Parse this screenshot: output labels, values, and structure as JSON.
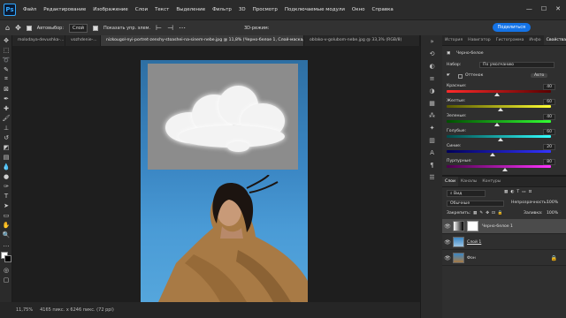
{
  "app": {
    "logo": "Ps"
  },
  "menu": [
    "Файл",
    "Редактирование",
    "Изображение",
    "Слои",
    "Текст",
    "Выделение",
    "Фильтр",
    "3D",
    "Просмотр",
    "Подключаемые модули",
    "Окно",
    "Справка"
  ],
  "window_controls": [
    "—",
    "☐",
    "✕"
  ],
  "options": {
    "auto_select_label": "Автовыбор:",
    "auto_select_value": "Слой",
    "show_controls_label": "Показать упр. элем.",
    "mode_3d_label": "3D-режим:",
    "share_label": "Поделиться"
  },
  "tabs": [
    {
      "label": "molodaya-devushka-...",
      "active": false
    },
    {
      "label": "vozhdenie-...",
      "active": false
    },
    {
      "label": "nizkougol-nyi-portret-zenshy-stoashei-na-sinem-nebe.jpg @ 11,8% (Черно-белое 1, Слой-маска/8) *",
      "active": true
    },
    {
      "label": "oblako-v-golubom-nebe.jpg @ 33,3% (RGB/8)",
      "active": false
    }
  ],
  "status": {
    "zoom": "11,75%",
    "doc_size": "4165 пикс. x 6246 пикс. (72 ppi)"
  },
  "properties": {
    "tabs": [
      "История",
      "Навигатор",
      "Гистограмма",
      "Инфо",
      "Свойства"
    ],
    "title": "Черно-белое",
    "preset_label": "Набор:",
    "preset_value": "По умолчанию",
    "tint_label": "Оттенок",
    "auto_label": "Авто",
    "sliders": [
      {
        "label": "Красные:",
        "value": 40,
        "color_from": "#ff2a2a",
        "color_to": "#5a0000"
      },
      {
        "label": "Желтые:",
        "value": 60,
        "color_from": "#5a5a00",
        "color_to": "#ffff33"
      },
      {
        "label": "Зеленые:",
        "value": 40,
        "color_from": "#004d00",
        "color_to": "#33ff33"
      },
      {
        "label": "Голубые:",
        "value": 60,
        "color_from": "#004d4d",
        "color_to": "#33ffff"
      },
      {
        "label": "Синие:",
        "value": 20,
        "color_from": "#00005a",
        "color_to": "#3333ff"
      },
      {
        "label": "Пурпурные:",
        "value": 80,
        "color_from": "#4d004d",
        "color_to": "#ff33ff"
      }
    ]
  },
  "layers": {
    "tabs": [
      "Слои",
      "Каналы",
      "Контуры"
    ],
    "filter_label": "Вид",
    "blend_mode": "Обычные",
    "opacity_label": "Непрозрачность:",
    "opacity_value": "100%",
    "lock_label": "Закрепить:",
    "fill_label": "Заливка:",
    "fill_value": "100%",
    "items": [
      {
        "name": "Черно-белое 1",
        "selected": true,
        "has_mask": true
      },
      {
        "name": "Слой 1",
        "selected": false,
        "has_mask": false
      },
      {
        "name": "Фон",
        "selected": false,
        "has_mask": false,
        "locked": true
      }
    ]
  }
}
